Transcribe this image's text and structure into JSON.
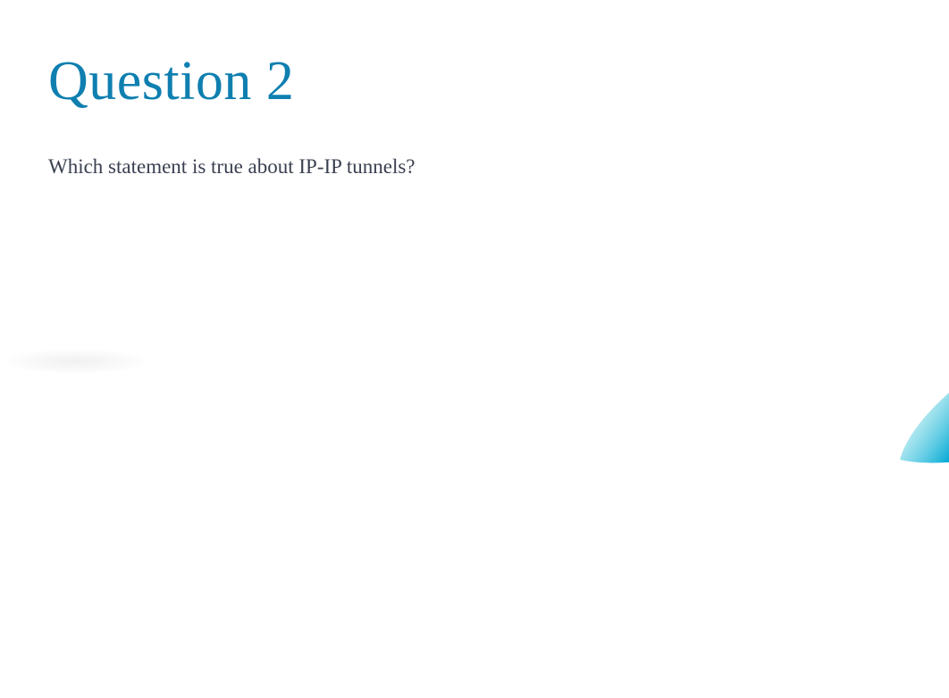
{
  "question": {
    "title": "Question 2",
    "text": "Which statement is true about IP-IP tunnels?"
  }
}
